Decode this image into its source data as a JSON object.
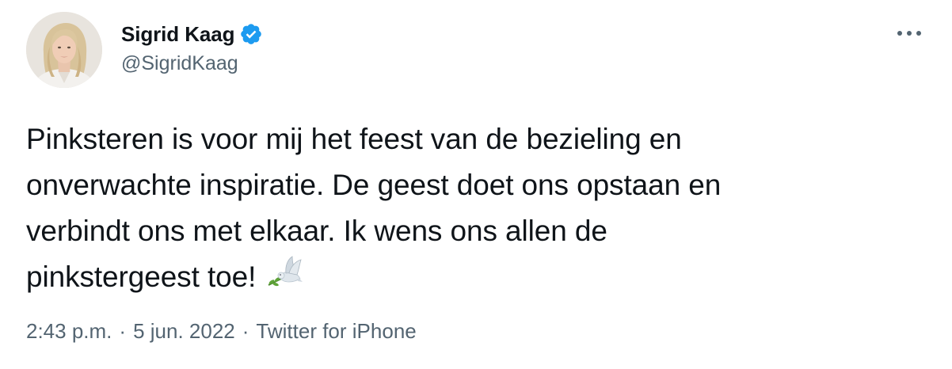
{
  "author": {
    "display_name": "Sigrid Kaag",
    "handle": "@SigridKaag",
    "verified": true,
    "avatar_icon": "profile-photo"
  },
  "more_options_icon": "more-horizontal-icon",
  "tweet": {
    "text": "Pinksteren is voor mij het feest van de bezieling en\nonverwachte inspiratie. De geest doet ons opstaan en\nverbindt ons met elkaar. Ik wens ons allen de\npinkstergeest toe!",
    "emoji_icon": "dove-icon"
  },
  "meta": {
    "time": "2:43 p.m.",
    "separator": "·",
    "date": "5 jun. 2022",
    "source": "Twitter for iPhone"
  },
  "colors": {
    "verified_blue": "#1d9bf0",
    "secondary_text": "#536471",
    "primary_text": "#0f1419"
  }
}
